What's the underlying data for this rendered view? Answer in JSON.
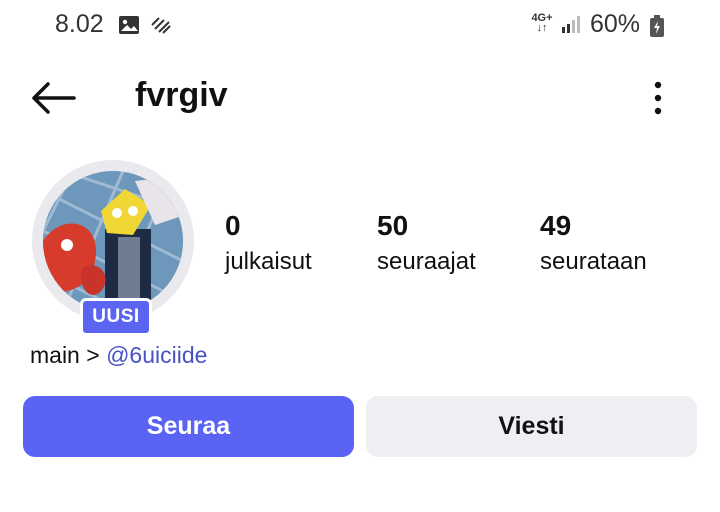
{
  "status_bar": {
    "time": "8.02",
    "network_label_top": "4G+",
    "network_label_bottom": "↓↑",
    "battery_percent": "60%",
    "icons": [
      "image-icon",
      "data-sync-icon",
      "signal-bars-icon",
      "battery-icon"
    ]
  },
  "header": {
    "username": "fvrgiv",
    "icons": [
      "back-arrow-icon",
      "more-vertical-icon"
    ]
  },
  "profile": {
    "badge": "UUSI",
    "stats": [
      {
        "value": "0",
        "label": "julkaisut"
      },
      {
        "value": "50",
        "label": "seuraajat"
      },
      {
        "value": "49",
        "label": "seurataan"
      }
    ],
    "bio_prefix": "main > ",
    "bio_mention": "@6uiciide"
  },
  "actions": {
    "follow_label": "Seuraa",
    "message_label": "Viesti"
  },
  "colors": {
    "accent": "#5a63f4",
    "mention": "#4752c4",
    "secondary_button": "#eeeff3"
  }
}
